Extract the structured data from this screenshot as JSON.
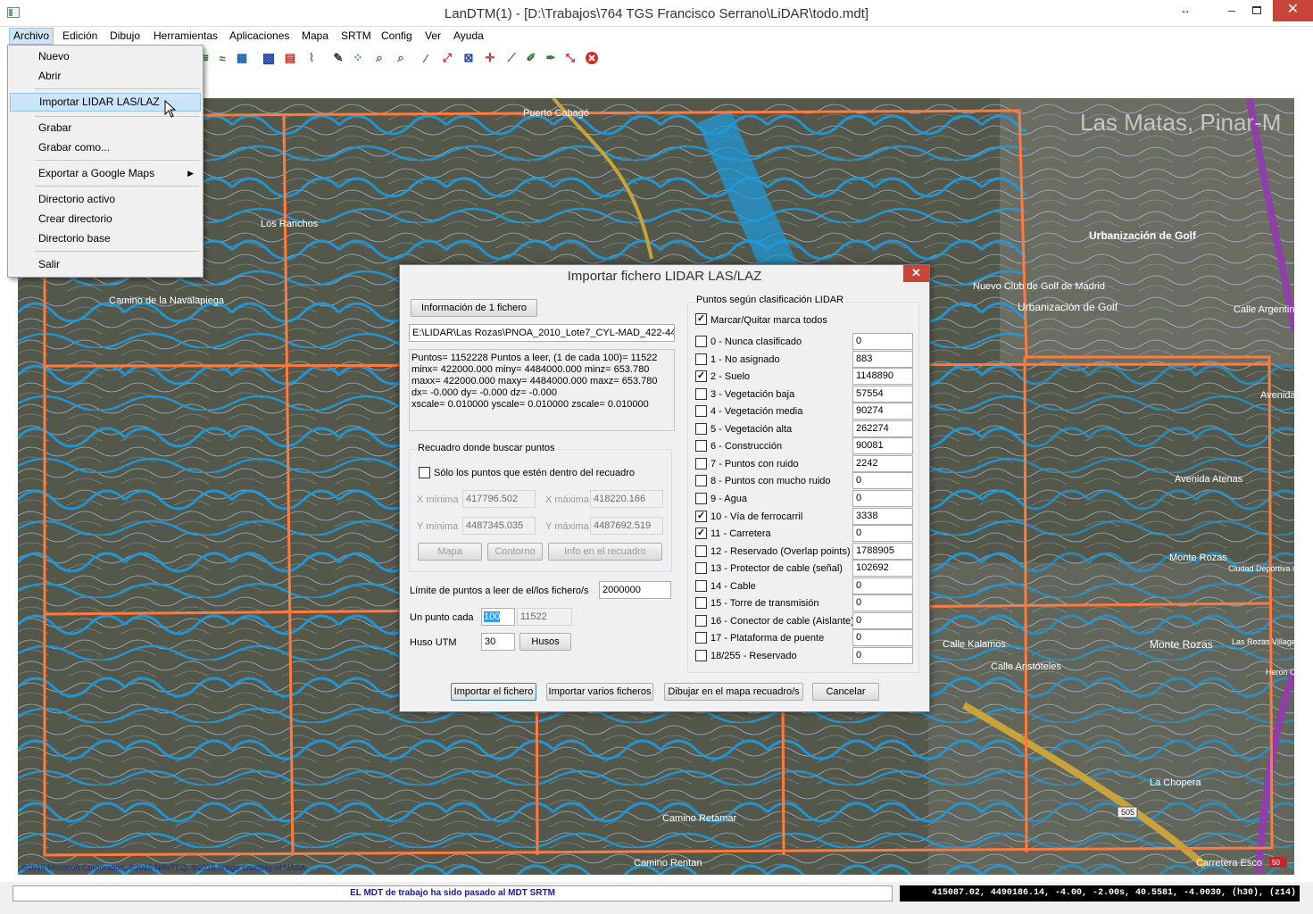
{
  "window": {
    "title": "LanDTM(1) - [D:\\Trabajos\\764 TGS Francisco Serrano\\LiDAR\\todo.mdt]",
    "restore_glyph": "↔",
    "minimize_glyph": "–",
    "close_glyph": "✕"
  },
  "menubar": [
    "Archivo",
    "Edición",
    "Dibujo",
    "Herramientas",
    "Aplicaciones",
    "Mapa",
    "SRTM",
    "Config",
    "Ver",
    "Ayuda"
  ],
  "archivo_menu": {
    "items": [
      "Nuevo",
      "Abrir",
      "Importar LIDAR LAS/LAZ",
      "Grabar",
      "Grabar como...",
      "Exportar a Google Maps",
      "Directorio activo",
      "Crear directorio",
      "Directorio base",
      "Salir"
    ],
    "submenu_arrow": "▶"
  },
  "toolbar": {
    "icons": [
      "contour-icon",
      "contour-alt-icon",
      "map-icon",
      "grid-icon",
      "table-icon",
      "profile-icon",
      "pencil-icon",
      "edit-points-icon",
      "zoom-icon",
      "zoom-window-icon",
      "measure-icon",
      "line-icon",
      "fit-icon",
      "crosshair-icon",
      "brush-icon",
      "draw-icon",
      "fill-icon",
      "pick-icon",
      "stop-icon"
    ]
  },
  "map": {
    "copyright": "©2015 Microsoft Corporation, ©2015 NAVTEQ, ©2015 Image courtesy of NASA",
    "labels": [
      "Las Matas, Pinar-M",
      "Los Ranchos",
      "Puerto Cabagó",
      "Urbanización de Golf",
      "Nuevo Club de Golf de Madrid",
      "Urbanización de Golf",
      "Calle Argentina",
      "Avenida",
      "Avenida Atenas",
      "Monte Rozas",
      "Ciudad Deportiva de la Rof",
      "Calle Kalamos",
      "Calle Aristóteles",
      "Monte Rozas",
      "Las Rozas Village",
      "Heron Ci",
      "La Chopera",
      "Camino Retamar",
      "Carretera Esco",
      "Camino de la Navalapiega",
      "Camino Rentan",
      "505",
      "50"
    ],
    "colors": {
      "contour_major": "#1b9be0",
      "contour_minor": "#b8d8ff",
      "grid": "#ff7a3d",
      "road": "#c8a23a",
      "highway": "#8e3fa8",
      "terrain": "#54584a"
    }
  },
  "dialog": {
    "title": "Importar fichero LIDAR LAS/LAZ",
    "info_button": "Información de 1 fichero",
    "file_path": "E:\\LIDAR\\Las Rozas\\PNOA_2010_Lote7_CYL-MAD_422-4484",
    "info_text": "Puntos= 1152228 Puntos a leer, (1 de cada 100)= 11522\nminx= 422000.000 miny= 4484000.000 minz= 653.780\nmaxx= 422000.000 maxy= 4484000.000 maxz= 653.780\ndx= -0.000 dy= -0.000 dz= -0.000\nxscale= 0.010000 yscale= 0.010000 zscale= 0.010000",
    "box_group": {
      "title": "Recuadro donde buscar puntos",
      "only_inside_label": "Sólo los puntos que estén dentro del recuadro",
      "only_inside_checked": false,
      "x_min_label": "X mínima",
      "x_min": "417796.502",
      "x_max_label": "X máxima",
      "x_max": "418220.166",
      "y_min_label": "Y mínima",
      "y_min": "4487345.035",
      "y_max_label": "Y máxima",
      "y_max": "4487692.519",
      "map_button": "Mapa",
      "contour_button": "Contorno",
      "info_box_button": "Info en el recuadro"
    },
    "limit_label": "Límite de puntos a leer de el/los fichero/s",
    "limit_value": "2000000",
    "every_label": "Un punto cada",
    "every_value": "100",
    "every_result": "11522",
    "utm_label": "Huso UTM",
    "utm_value": "30",
    "utm_button": "Husos",
    "classification": {
      "title": "Puntos según clasificación LIDAR",
      "toggle_all_label": "Marcar/Quitar marca todos",
      "toggle_all_checked": true,
      "rows": [
        {
          "label": "0 - Nunca clasificado",
          "count": "0",
          "checked": false
        },
        {
          "label": "1 - No asignado",
          "count": "883",
          "checked": false
        },
        {
          "label": "2 - Suelo",
          "count": "1148890",
          "checked": true
        },
        {
          "label": "3 - Vegetación baja",
          "count": "57554",
          "checked": false
        },
        {
          "label": "4 - Vegetación media",
          "count": "90274",
          "checked": false
        },
        {
          "label": "5 - Vegetación alta",
          "count": "262274",
          "checked": false
        },
        {
          "label": "6 - Construcción",
          "count": "90081",
          "checked": false
        },
        {
          "label": "7 - Puntos con ruido",
          "count": "2242",
          "checked": false
        },
        {
          "label": "8 - Puntos con mucho ruido",
          "count": "0",
          "checked": false
        },
        {
          "label": "9 - Agua",
          "count": "0",
          "checked": false
        },
        {
          "label": "10 - Vía de ferrocarril",
          "count": "3338",
          "checked": true
        },
        {
          "label": "11 - Carretera",
          "count": "0",
          "checked": true
        },
        {
          "label": "12 - Reservado (Overlap points)",
          "count": "1788905",
          "checked": false
        },
        {
          "label": "13 - Protector de cable (señal)",
          "count": "102692",
          "checked": false
        },
        {
          "label": "14 - Cable",
          "count": "0",
          "checked": false
        },
        {
          "label": "15 - Torre de transmisión",
          "count": "0",
          "checked": false
        },
        {
          "label": "16 - Conector de cable (Aislante)",
          "count": "0",
          "checked": false
        },
        {
          "label": "17 - Plataforma de puente",
          "count": "0",
          "checked": false
        },
        {
          "label": "18/255 - Reservado",
          "count": "0",
          "checked": false
        }
      ]
    },
    "buttons": {
      "import": "Importar el fichero",
      "import_multi": "Importar varios ficheros",
      "draw_box": "Dibujar en el mapa recuadro/s",
      "cancel": "Cancelar"
    }
  },
  "status": {
    "message": "EL MDT de trabajo ha sido pasado al MDT SRTM",
    "coords": "415087.02, 4490186.14, -4.00, -2.00s, 40.5581, -4.0030, (h30), (z14)"
  }
}
